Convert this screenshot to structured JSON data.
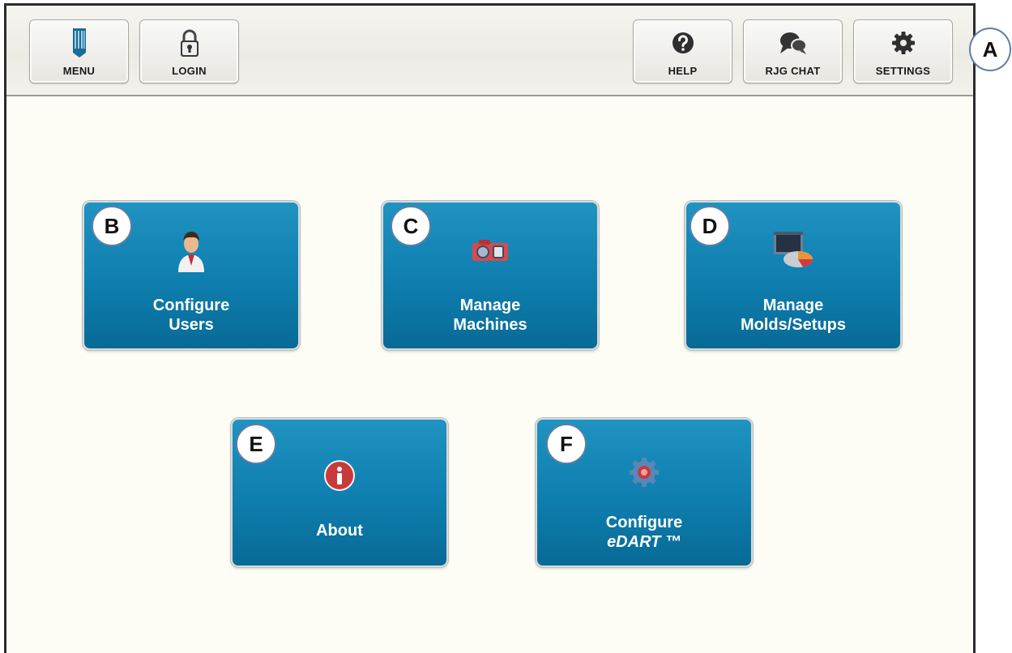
{
  "toolbar": {
    "menu_label": "MENU",
    "login_label": "LOGIN",
    "help_label": "HELP",
    "chat_label": "RJG CHAT",
    "settings_label": "SETTINGS"
  },
  "tiles": [
    {
      "id": "B",
      "line1": "Configure",
      "line2": "Users",
      "icon": "user-icon"
    },
    {
      "id": "C",
      "line1": "Manage",
      "line2": "Machines",
      "icon": "machine-icon"
    },
    {
      "id": "D",
      "line1": "Manage",
      "line2": "Molds/Setups",
      "icon": "molds-setups-icon"
    },
    {
      "id": "E",
      "line1": "About",
      "line2": "",
      "icon": "info-icon"
    },
    {
      "id": "F",
      "line1": "Configure",
      "line2": "eDART ™",
      "icon": "gear-icon"
    }
  ],
  "callouts": {
    "a": "A",
    "b": "B",
    "c": "C",
    "d": "D",
    "e": "E",
    "f": "F"
  },
  "colors": {
    "tile": "#0e7eae",
    "background": "#fdfdf6",
    "callout_border": "#5d7fa6"
  }
}
